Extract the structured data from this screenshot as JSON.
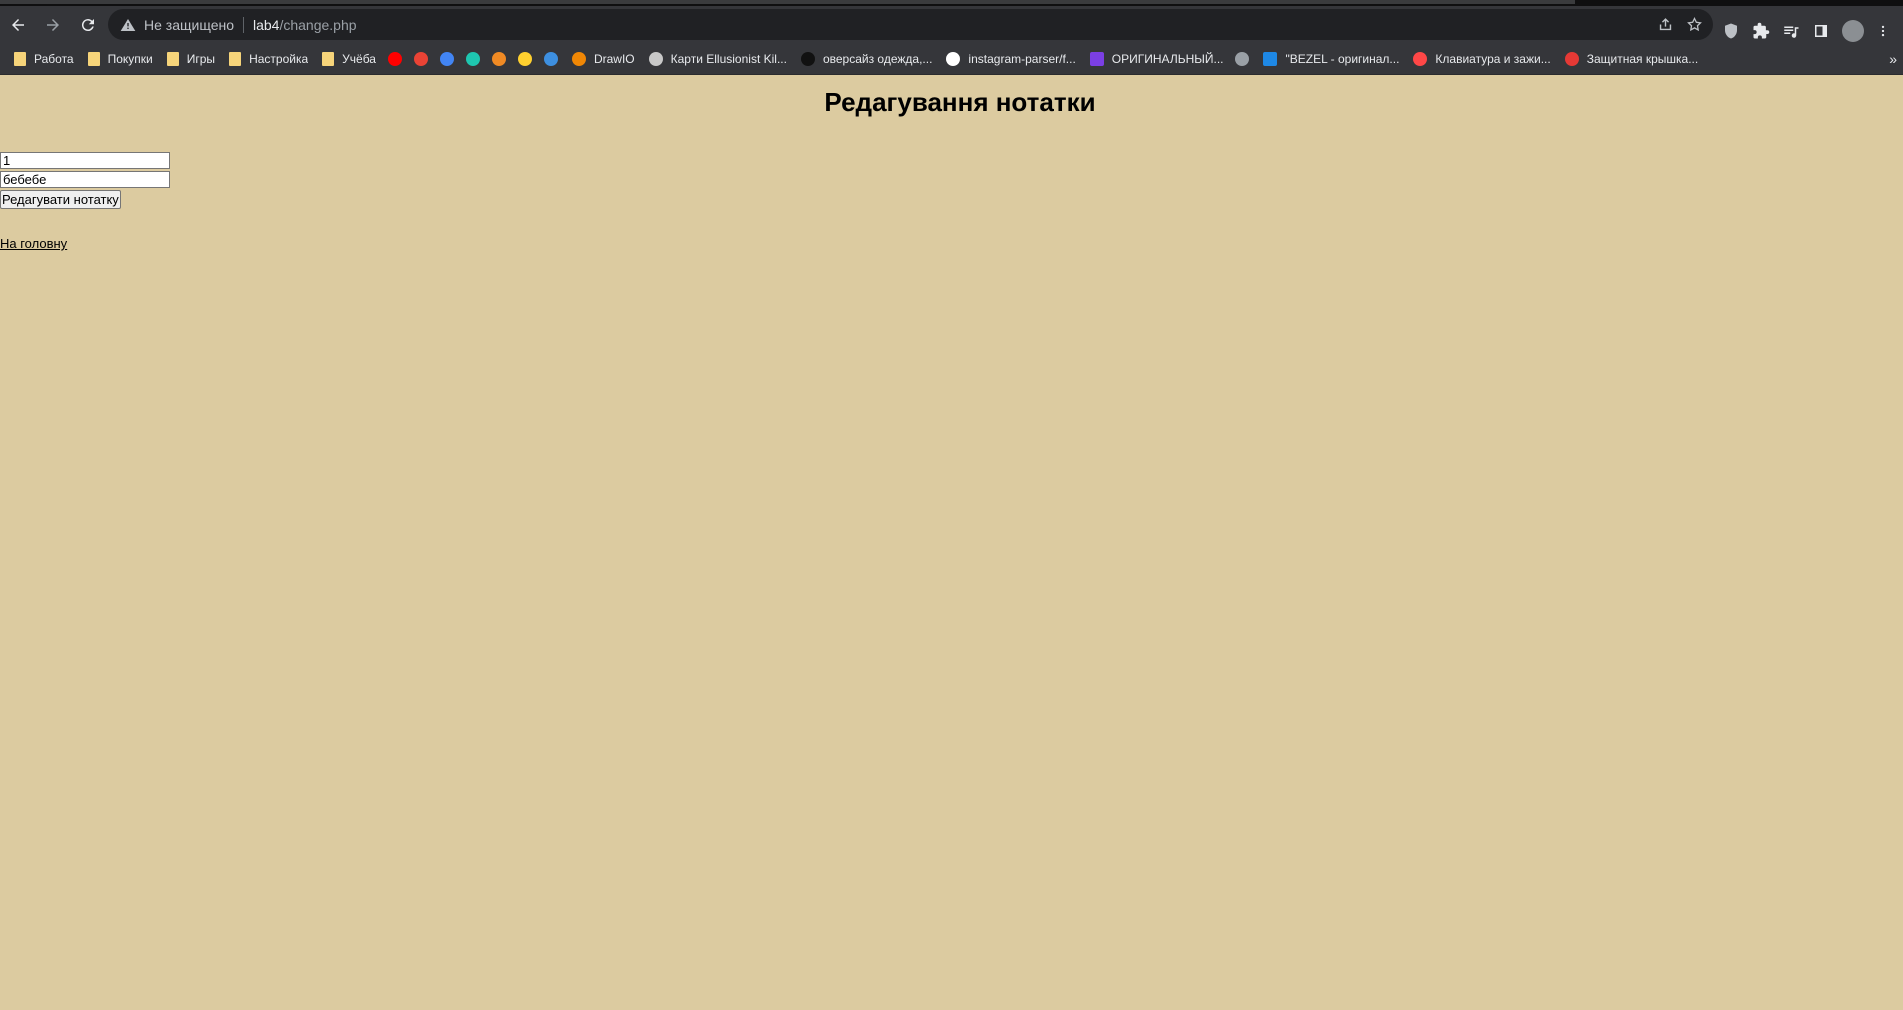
{
  "browser": {
    "address_bar": {
      "security_label": "Не защищено",
      "url_host": "lab4",
      "url_path": "/change.php"
    },
    "bookmarks": [
      {
        "label": "Работа",
        "icon": "folder-icon",
        "color": "#f6d47a"
      },
      {
        "label": "Покупки",
        "icon": "folder-icon",
        "color": "#f6d47a"
      },
      {
        "label": "Игры",
        "icon": "folder-icon",
        "color": "#f6d47a"
      },
      {
        "label": "Настройка",
        "icon": "folder-icon",
        "color": "#f6d47a"
      },
      {
        "label": "Учёба",
        "icon": "folder-icon",
        "color": "#f6d47a"
      },
      {
        "label": "",
        "icon": "youtube-icon",
        "color": "#ff0000"
      },
      {
        "label": "",
        "icon": "gmail-icon",
        "color": "#ea4335"
      },
      {
        "label": "",
        "icon": "pinwheel-icon",
        "color": "#4285f4"
      },
      {
        "label": "",
        "icon": "round-teal-icon",
        "color": "#1ec6b0"
      },
      {
        "label": "",
        "icon": "diamond-icon",
        "color": "#f08a24"
      },
      {
        "label": "",
        "icon": "miro-icon",
        "color": "#ffd02f"
      },
      {
        "label": "",
        "icon": "shield-app-icon",
        "color": "#3d8fe0"
      },
      {
        "label": "DrawIO",
        "icon": "drawio-icon",
        "color": "#f08705"
      },
      {
        "label": "Карти Ellusionist Kil...",
        "icon": "gear-flower-icon",
        "color": "#c8c8c8"
      },
      {
        "label": "оверсайз одежда,...",
        "icon": "spider-icon",
        "color": "#111111"
      },
      {
        "label": "instagram-parser/f...",
        "icon": "github-icon",
        "color": "#ffffff"
      },
      {
        "label": "ОРИГИНАЛЬНЫЙ...",
        "icon": "purple-square-icon",
        "color": "#7b3fe4"
      },
      {
        "label": "",
        "icon": "globe-icon",
        "color": "#9aa0a6"
      },
      {
        "label": "\"BEZEL - оригинал...",
        "icon": "b-square-icon",
        "color": "#1e88e5"
      },
      {
        "label": "Клавиатура и зажи...",
        "icon": "aliexpress-icon",
        "color": "#ff4747"
      },
      {
        "label": "Защитная крышка...",
        "icon": "red-circle-icon",
        "color": "#e53935"
      }
    ],
    "bookmarks_more": "»"
  },
  "page": {
    "title": "Редагування нотатки",
    "form": {
      "id_value": "1",
      "text_value": "бебебе",
      "submit_label": "Редагувати нотатку"
    },
    "home_link": "На головну",
    "background": "#dccba0"
  }
}
